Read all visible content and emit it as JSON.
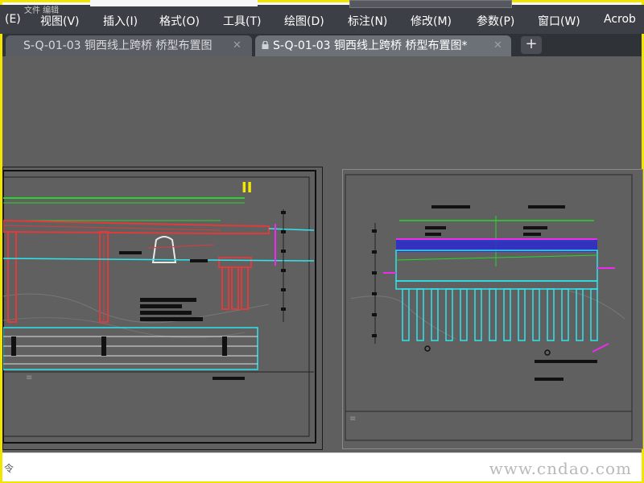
{
  "menu": {
    "items": [
      "(E)",
      "视图(V)",
      "插入(I)",
      "格式(O)",
      "工具(T)",
      "绘图(D)",
      "标注(N)",
      "修改(M)",
      "参数(P)",
      "窗口(W)",
      "Acrob"
    ],
    "ghost_text": "文件 编辑"
  },
  "tabs": [
    {
      "label": "S-Q-01-03 铜西线上跨桥 桥型布置图",
      "close": "✕"
    },
    {
      "label": "S-Q-01-03 铜西线上跨桥 桥型布置图*",
      "close": "✕"
    }
  ],
  "new_tab": "+",
  "drawing": {
    "section_marker": "II"
  },
  "command_line": {
    "prompt": "令"
  },
  "watermark": "www.cndao.com",
  "colors": {
    "accent_frame": "#f2e600",
    "cad_red": "#e03a3a",
    "cad_green": "#29d42c",
    "cad_cyan": "#2ee6ee",
    "cad_magenta": "#ee2aee",
    "cad_blue": "#2a2ad0",
    "cad_yellow": "#f5e800"
  },
  "icons": [
    "lock-icon",
    "close-icon",
    "plus-icon"
  ]
}
